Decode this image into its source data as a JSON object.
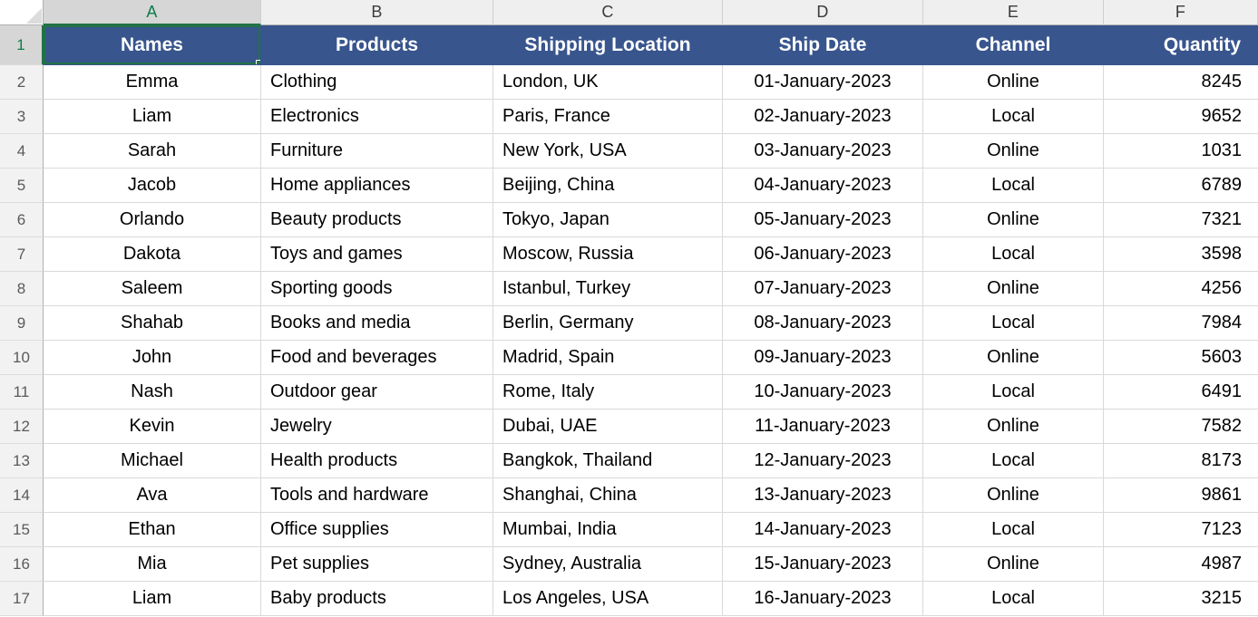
{
  "app": {
    "type": "spreadsheet",
    "selected_cell": "A1",
    "accent_selection_color": "#217346",
    "header_fill_color": "#38558E",
    "header_text_color": "#FFFFFF",
    "gridline_color": "#D9D9D9"
  },
  "grid": {
    "select_all_icon": "select-all-triangle-icon",
    "column_letters": [
      "A",
      "B",
      "C",
      "D",
      "E",
      "F"
    ],
    "row_numbers": [
      "1",
      "2",
      "3",
      "4",
      "5",
      "6",
      "7",
      "8",
      "9",
      "10",
      "11",
      "12",
      "13",
      "14",
      "15",
      "16",
      "17"
    ]
  },
  "table": {
    "headers": [
      "Names",
      "Products",
      "Shipping Location",
      "Ship Date",
      "Channel",
      "Quantity"
    ],
    "rows": [
      [
        "Emma",
        "Clothing",
        "London, UK",
        "01-January-2023",
        "Online",
        "8245"
      ],
      [
        "Liam",
        "Electronics",
        "Paris, France",
        "02-January-2023",
        "Local",
        "9652"
      ],
      [
        "Sarah",
        "Furniture",
        "New York, USA",
        "03-January-2023",
        "Online",
        "1031"
      ],
      [
        "Jacob",
        "Home appliances",
        "Beijing, China",
        "04-January-2023",
        "Local",
        "6789"
      ],
      [
        "Orlando",
        "Beauty products",
        "Tokyo, Japan",
        "05-January-2023",
        "Online",
        "7321"
      ],
      [
        "Dakota",
        "Toys and games",
        "Moscow, Russia",
        "06-January-2023",
        "Local",
        "3598"
      ],
      [
        "Saleem",
        "Sporting goods",
        "Istanbul, Turkey",
        "07-January-2023",
        "Online",
        "4256"
      ],
      [
        "Shahab",
        "Books and media",
        "Berlin, Germany",
        "08-January-2023",
        "Local",
        "7984"
      ],
      [
        "John",
        "Food and beverages",
        "Madrid, Spain",
        "09-January-2023",
        "Online",
        "5603"
      ],
      [
        "Nash",
        "Outdoor gear",
        "Rome, Italy",
        "10-January-2023",
        "Local",
        "6491"
      ],
      [
        "Kevin",
        "Jewelry",
        "Dubai, UAE",
        "11-January-2023",
        "Online",
        "7582"
      ],
      [
        "Michael",
        "Health products",
        "Bangkok, Thailand",
        "12-January-2023",
        "Local",
        "8173"
      ],
      [
        "Ava",
        "Tools and hardware",
        "Shanghai, China",
        "13-January-2023",
        "Online",
        "9861"
      ],
      [
        "Ethan",
        "Office supplies",
        "Mumbai, India",
        "14-January-2023",
        "Local",
        "7123"
      ],
      [
        "Mia",
        "Pet supplies",
        "Sydney, Australia",
        "15-January-2023",
        "Online",
        "4987"
      ],
      [
        "Liam",
        "Baby products",
        "Los Angeles, USA",
        "16-January-2023",
        "Local",
        "3215"
      ]
    ],
    "column_alignments": [
      "center",
      "left",
      "left",
      "center",
      "center",
      "right"
    ]
  }
}
